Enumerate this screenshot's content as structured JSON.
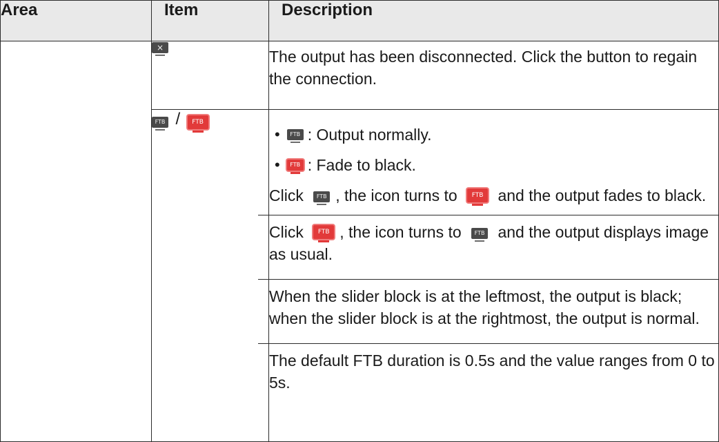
{
  "table": {
    "headers": [
      "Area",
      "Item",
      "Description"
    ],
    "row1": {
      "description": "The output has been disconnected. Click the button to regain the connection."
    },
    "row2": {
      "item_separator": "/",
      "bullet1": ": Output normally.",
      "bullet2": ": Fade to black.",
      "para1": {
        "t1": "Click",
        "t2": ", the icon turns to",
        "t3": "and the output fades to black."
      },
      "para2": {
        "t1": "Click",
        "t2": ", the icon turns to",
        "t3": "and the output displays image as usual."
      },
      "para3": "When the slider block is at the leftmost, the output is black; when the slider block is at the rightmost, the output is normal.",
      "para4": "The default FTB duration is 0.5s and the value ranges from 0 to 5s."
    }
  },
  "icons": {
    "close_glyph": "×",
    "ftb_label": "FTB"
  },
  "colors": {
    "header_bg": "#e9e9e9",
    "icon_dark": "#4a4a4a",
    "icon_red": "#e23a3a"
  }
}
